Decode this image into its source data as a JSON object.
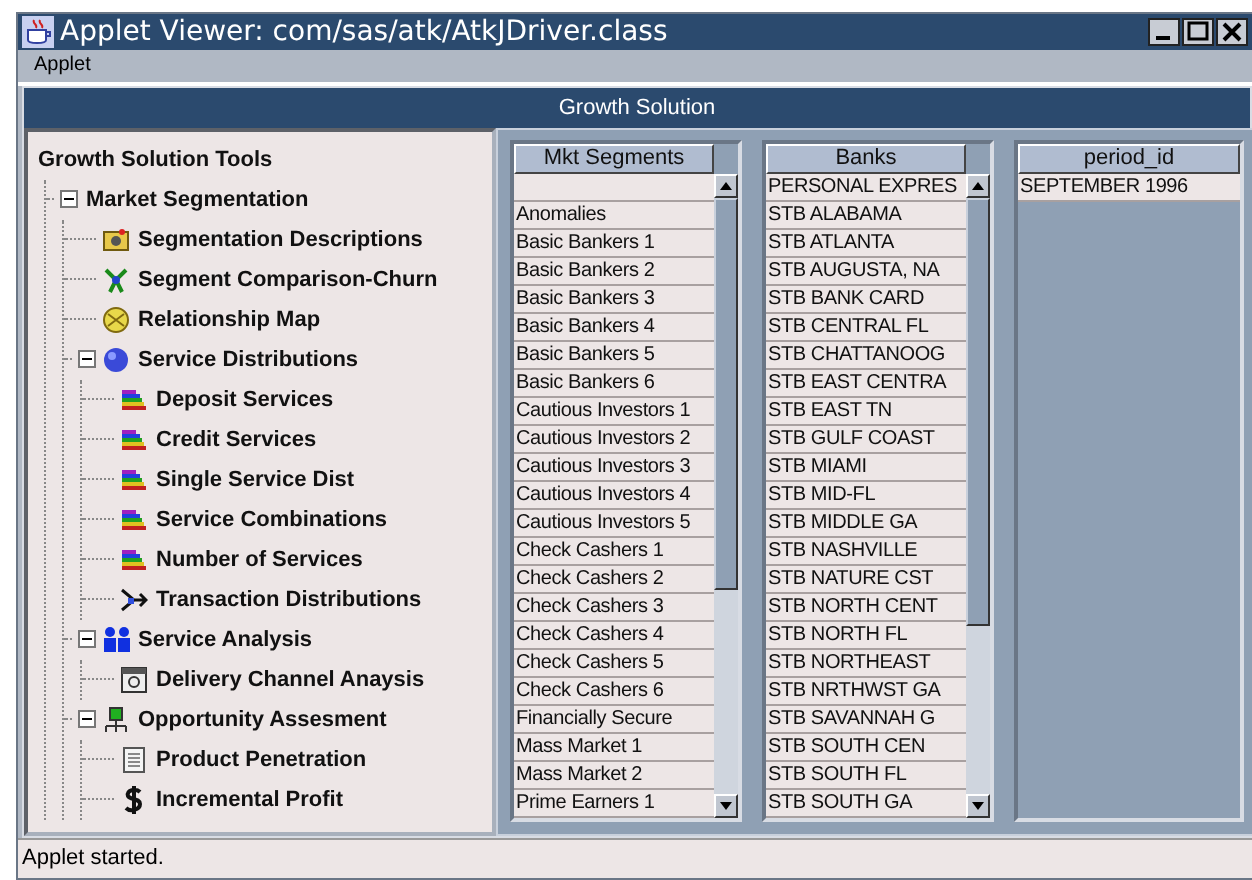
{
  "window": {
    "title": "Applet Viewer: com/sas/atk/AtkJDriver.class"
  },
  "menu_bar": [
    "Applet"
  ],
  "header": {
    "title": "Growth Solution"
  },
  "tree": {
    "label": "Growth Solution Tools",
    "children": [
      {
        "label": "Market Segmentation",
        "expanded": true,
        "children": [
          {
            "label": "Segmentation Descriptions",
            "kind": "folder"
          },
          {
            "label": "Segment Comparison-Churn",
            "kind": "network"
          },
          {
            "label": "Relationship Map",
            "kind": "globe"
          },
          {
            "label": "Service Distributions",
            "kind": "sphere",
            "expanded": true,
            "children": [
              {
                "label": "Deposit Services",
                "kind": "bars"
              },
              {
                "label": "Credit Services",
                "kind": "bars"
              },
              {
                "label": "Single Service Dist",
                "kind": "bars"
              },
              {
                "label": "Service Combinations",
                "kind": "bars"
              },
              {
                "label": "Number of Services",
                "kind": "bars"
              },
              {
                "label": "Transaction Distributions",
                "kind": "arrow"
              }
            ]
          },
          {
            "label": "Service Analysis",
            "kind": "people",
            "expanded": true,
            "children": [
              {
                "label": "Delivery Channel Anaysis",
                "kind": "window"
              }
            ]
          },
          {
            "label": "Opportunity Assesment",
            "kind": "org",
            "expanded": true,
            "children": [
              {
                "label": "Product Penetration",
                "kind": "document"
              },
              {
                "label": "Incremental Profit",
                "kind": "dollar"
              }
            ]
          }
        ]
      }
    ]
  },
  "lists": [
    {
      "heading": "Mkt Segments",
      "scrollable": true,
      "blank_first_row": true,
      "items": [
        "Anomalies",
        "Basic Bankers 1",
        "Basic Bankers 2",
        "Basic Bankers 3",
        "Basic Bankers 4",
        "Basic Bankers 5",
        "Basic Bankers 6",
        "Cautious Investors 1",
        "Cautious Investors 2",
        "Cautious Investors 3",
        "Cautious Investors 4",
        "Cautious Investors 5",
        "Check Cashers 1",
        "Check Cashers 2",
        "Check Cashers 3",
        "Check Cashers 4",
        "Check Cashers 5",
        "Check Cashers 6",
        "Financially Secure",
        "Mass Market 1",
        "Mass Market 2",
        "Prime Earners 1"
      ]
    },
    {
      "heading": "Banks",
      "scrollable": true,
      "items": [
        "PERSONAL EXPRES",
        "STB ALABAMA",
        "STB ATLANTA",
        "STB AUGUSTA, NA",
        "STB BANK CARD",
        "STB CENTRAL FL",
        "STB CHATTANOOG",
        "STB EAST CENTRA",
        "STB EAST TN",
        "STB GULF COAST",
        "STB MIAMI",
        "STB MID-FL",
        "STB MIDDLE GA",
        "STB NASHVILLE",
        "STB NATURE CST",
        "STB NORTH CENT",
        "STB NORTH FL",
        "STB NORTHEAST",
        "STB NRTHWST GA",
        "STB SAVANNAH G",
        "STB SOUTH CEN",
        "STB SOUTH FL",
        "STB SOUTH GA"
      ]
    },
    {
      "heading": "period_id",
      "scrollable": false,
      "items": [
        "SEPTEMBER 1996"
      ]
    }
  ],
  "status_bar": "Applet started."
}
